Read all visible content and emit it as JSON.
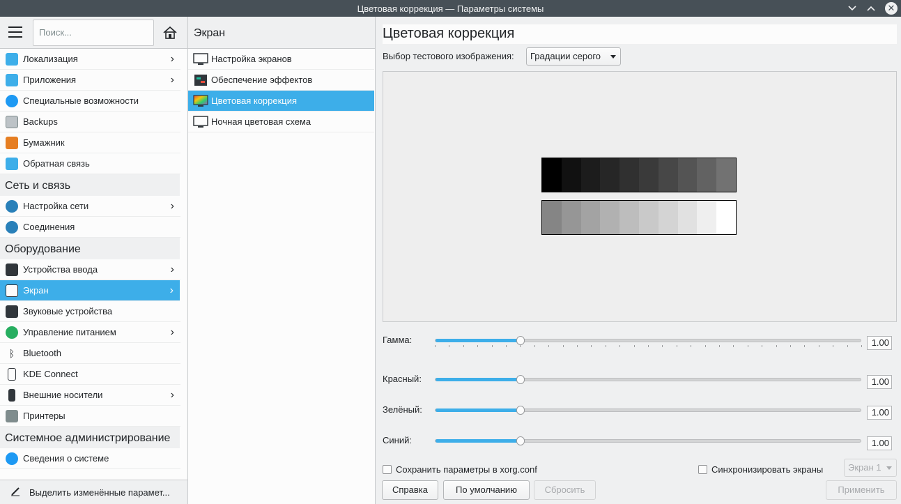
{
  "window": {
    "title": "Цветовая коррекция  — Параметры системы"
  },
  "sidebar": {
    "search_placeholder": "Поиск...",
    "items_top": [
      {
        "label": "Локализация",
        "chevron": true
      },
      {
        "label": "Приложения",
        "chevron": true
      },
      {
        "label": "Специальные возможности",
        "chevron": false
      },
      {
        "label": "Backups",
        "chevron": false
      },
      {
        "label": "Бумажник",
        "chevron": false
      },
      {
        "label": "Обратная связь",
        "chevron": false
      }
    ],
    "section_network": "Сеть и связь",
    "items_network": [
      {
        "label": "Настройка сети",
        "chevron": true
      },
      {
        "label": "Соединения",
        "chevron": false
      }
    ],
    "section_hardware": "Оборудование",
    "items_hardware": [
      {
        "label": "Устройства ввода",
        "chevron": true
      },
      {
        "label": "Экран",
        "chevron": true,
        "selected": true
      },
      {
        "label": "Звуковые устройства",
        "chevron": false
      },
      {
        "label": "Управление питанием",
        "chevron": true
      },
      {
        "label": "Bluetooth",
        "chevron": false
      },
      {
        "label": "KDE Connect",
        "chevron": false
      },
      {
        "label": "Внешние носители",
        "chevron": true
      },
      {
        "label": "Принтеры",
        "chevron": false
      }
    ],
    "section_admin": "Системное администрирование",
    "items_admin": [
      {
        "label": "Сведения о системе",
        "chevron": false
      }
    ],
    "footer_label": "Выделить изменённые парамет..."
  },
  "subnav": {
    "header": "Экран",
    "items": [
      {
        "label": "Настройка экранов"
      },
      {
        "label": "Обеспечение эффектов"
      },
      {
        "label": "Цветовая коррекция",
        "selected": true
      },
      {
        "label": "Ночная цветовая схема"
      }
    ]
  },
  "main": {
    "title": "Цветовая коррекция",
    "test_image_label": "Выбор тестового изображения:",
    "test_image_value": "Градации серого",
    "sliders": [
      {
        "label": "Гамма:",
        "value": "1.00",
        "fraction": 0.2
      },
      {
        "label": "Красный:",
        "value": "1.00",
        "fraction": 0.2
      },
      {
        "label": "Зелёный:",
        "value": "1.00",
        "fraction": 0.2
      },
      {
        "label": "Синий:",
        "value": "1.00",
        "fraction": 0.2
      }
    ],
    "save_xorg_label": "Сохранить параметры в xorg.conf",
    "sync_screens_label": "Синхронизировать экраны",
    "screen_select_value": "Экран 1",
    "buttons": {
      "help": "Справка",
      "defaults": "По умолчанию",
      "reset": "Сбросить",
      "apply": "Применить"
    },
    "gray_strip_top": [
      "#000000",
      "#111111",
      "#1c1c1c",
      "#262626",
      "#303030",
      "#3a3a3a",
      "#474747",
      "#545454",
      "#626262",
      "#727272"
    ],
    "gray_strip_bottom": [
      "#858585",
      "#969696",
      "#a3a3a3",
      "#b1b1b1",
      "#bdbdbd",
      "#c9c9c9",
      "#d4d4d4",
      "#e1e1e1",
      "#efefef",
      "#ffffff"
    ]
  },
  "colors": {
    "accent": "#3daee9",
    "titlebar": "#475057",
    "window_bg": "#eff0f1"
  }
}
